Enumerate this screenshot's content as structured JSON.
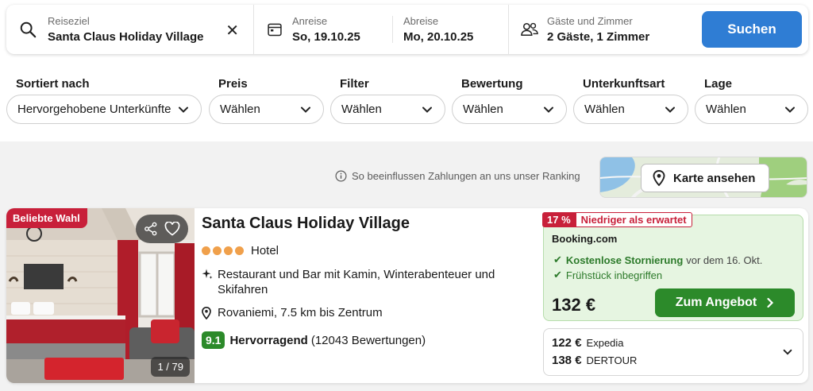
{
  "search": {
    "destination_label": "Reiseziel",
    "destination_value": "Santa Claus Holiday Village",
    "checkin_label": "Anreise",
    "checkin_value": "So, 19.10.25",
    "checkout_label": "Abreise",
    "checkout_value": "Mo, 20.10.25",
    "guests_label": "Gäste und Zimmer",
    "guests_value": "2 Gäste, 1 Zimmer",
    "button_label": "Suchen",
    "clear_icon": "close-icon",
    "accent_color": "#2f7dd4"
  },
  "filters": [
    {
      "label": "Sortiert nach",
      "value": "Hervorgehobene Unterkünfte"
    },
    {
      "label": "Preis",
      "value": "Wählen"
    },
    {
      "label": "Filter",
      "value": "Wählen"
    },
    {
      "label": "Bewertung",
      "value": "Wählen"
    },
    {
      "label": "Unterkunftsart",
      "value": "Wählen"
    },
    {
      "label": "Lage",
      "value": "Wählen"
    }
  ],
  "ranking_note": "So beeinflussen Zahlungen an uns unser Ranking",
  "map_button_label": "Karte ansehen",
  "hotel": {
    "popular_badge": "Beliebte Wahl",
    "photo_counter": "1 / 79",
    "name": "Santa Claus Holiday Village",
    "stars": 4,
    "type": "Hotel",
    "feature": "Restaurant und Bar mit Kamin, Winterabenteuer und Skifahren",
    "location": "Rovaniemi, 7.5 km bis Zentrum",
    "rating_score": "9.1",
    "rating_word": "Hervorragend",
    "rating_count": "(12043 Bewertungen)",
    "offer": {
      "discount": "17 %",
      "discount_label": "Niedriger als erwartet",
      "provider": "Booking.com",
      "condition1_bold": "Kostenlose Stornierung",
      "condition1_rest": "vor dem 16. Okt.",
      "condition2": "Frühstück inbegriffen",
      "price": "132 €",
      "button_label": "Zum Angebot",
      "button_color": "#2c8a2a"
    },
    "other_offers": [
      {
        "price": "122 €",
        "provider": "Expedia"
      },
      {
        "price": "138 €",
        "provider": "DERTOUR"
      }
    ]
  }
}
